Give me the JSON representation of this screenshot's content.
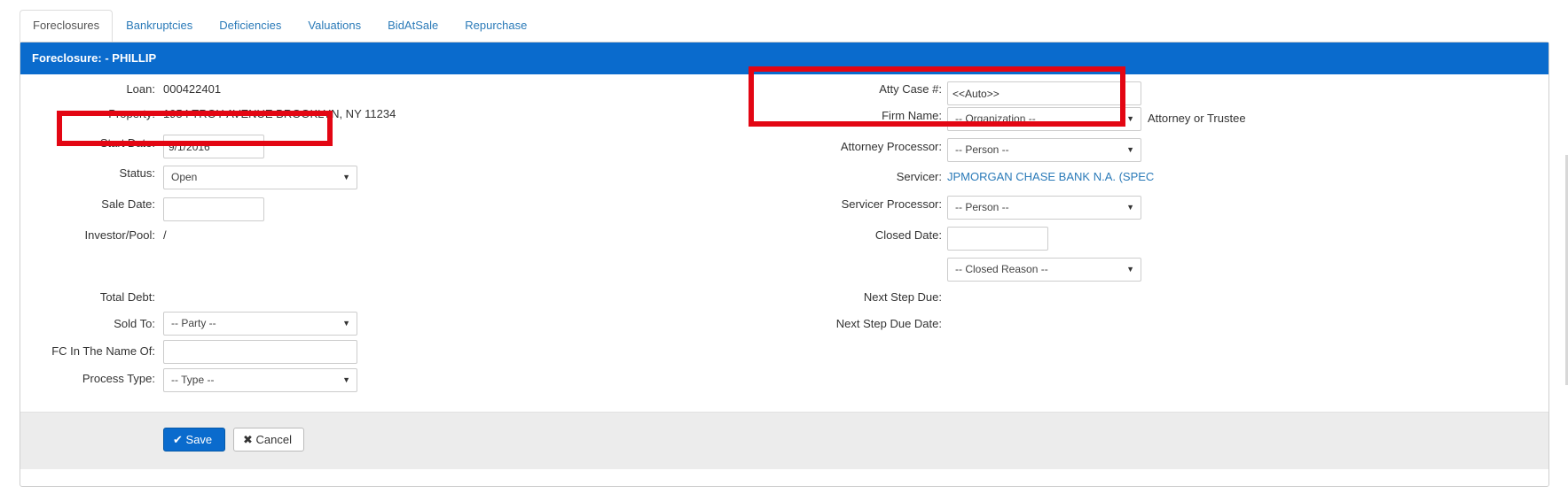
{
  "tabs": [
    {
      "label": "Foreclosures"
    },
    {
      "label": "Bankruptcies"
    },
    {
      "label": "Deficiencies"
    },
    {
      "label": "Valuations"
    },
    {
      "label": "BidAtSale"
    },
    {
      "label": "Repurchase"
    }
  ],
  "active_tab": "Foreclosures",
  "panel": {
    "title": "Foreclosure: - PHILLIP"
  },
  "left": {
    "loan_label": "Loan:",
    "loan_value": "000422401",
    "property_label": "Property:",
    "property_value": "1954 TROY AVENUE BROOKLYN, NY 11234",
    "start_date_label": "Start Date:",
    "start_date_value": "9/1/2016",
    "status_label": "Status:",
    "status_value": "Open",
    "sale_date_label": "Sale Date:",
    "sale_date_value": "",
    "investor_label": "Investor/Pool:",
    "investor_value": "/",
    "total_debt_label": "Total Debt:",
    "sold_to_label": "Sold To:",
    "sold_to_value": "-- Party --",
    "fc_name_label": "FC In The Name Of:",
    "fc_name_value": "",
    "process_type_label": "Process Type:",
    "process_type_value": "-- Type --"
  },
  "right": {
    "atty_case_label": "Atty Case #:",
    "atty_case_value": "<<Auto>>",
    "firm_name_label": "Firm Name:",
    "firm_name_value": "-- Organization --",
    "firm_name_hint": "Attorney or Trustee",
    "attorney_processor_label": "Attorney Processor:",
    "attorney_processor_value": "-- Person --",
    "servicer_label": "Servicer:",
    "servicer_value": "JPMORGAN CHASE BANK N.A. (SPEC",
    "servicer_processor_label": "Servicer Processor:",
    "servicer_processor_value": "-- Person --",
    "closed_date_label": "Closed Date:",
    "closed_date_value": "",
    "closed_reason_value": "-- Closed Reason --",
    "next_step_due_label": "Next Step Due:",
    "next_step_due_date_label": "Next Step Due Date:"
  },
  "actions": {
    "save_label": "Save",
    "cancel_label": "Cancel"
  },
  "colors": {
    "header_blue": "#0a6bcd",
    "highlight_red": "#e30613",
    "link_blue": "#2a7ab8"
  }
}
